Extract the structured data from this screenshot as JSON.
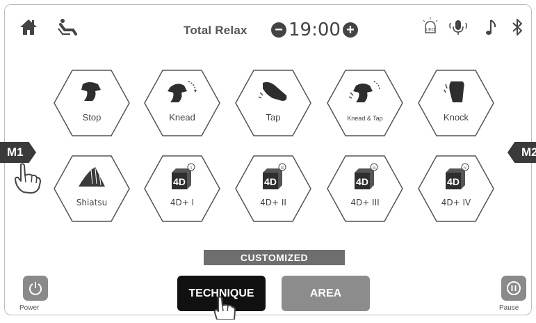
{
  "header": {
    "program_label": "Total Relax",
    "timer": "19:00",
    "minus_symbol": "−",
    "plus_symbol": "+",
    "icons_left": [
      "home-icon",
      "recline-icon"
    ],
    "icons_right": [
      "led-icon",
      "voice-icon",
      "music-icon",
      "bluetooth-icon"
    ],
    "led_text": "LED"
  },
  "techniques": {
    "row1": [
      {
        "label": "Stop",
        "icon": "stop-hand-icon"
      },
      {
        "label": "Knead",
        "icon": "knead-hand-icon"
      },
      {
        "label": "Tap",
        "icon": "tap-hand-icon"
      },
      {
        "label": "Knead & Tap",
        "icon": "knead-tap-hand-icon"
      },
      {
        "label": "Knock",
        "icon": "knock-hand-icon"
      }
    ],
    "row2": [
      {
        "label": "Shiatsu",
        "icon": "shiatsu-hand-icon"
      },
      {
        "label": "4D+ I",
        "icon": "4d-icon",
        "numeral": "I"
      },
      {
        "label": "4D+ II",
        "icon": "4d-icon",
        "numeral": "II"
      },
      {
        "label": "4D+ III",
        "icon": "4d-icon",
        "numeral": "III"
      },
      {
        "label": "4D+ IV",
        "icon": "4d-icon",
        "numeral": "IV"
      }
    ],
    "fourd_text": "4D"
  },
  "memory": {
    "left": "M1",
    "right": "M2"
  },
  "footer": {
    "customized_label": "CUSTOMIZED",
    "technique_label": "TECHNIQUE",
    "area_label": "AREA",
    "power_label": "Power",
    "pause_label": "Pause"
  },
  "colors": {
    "active_button": "#111111",
    "inactive_button": "#8c8c8c",
    "accent": "#3a3a3a"
  }
}
